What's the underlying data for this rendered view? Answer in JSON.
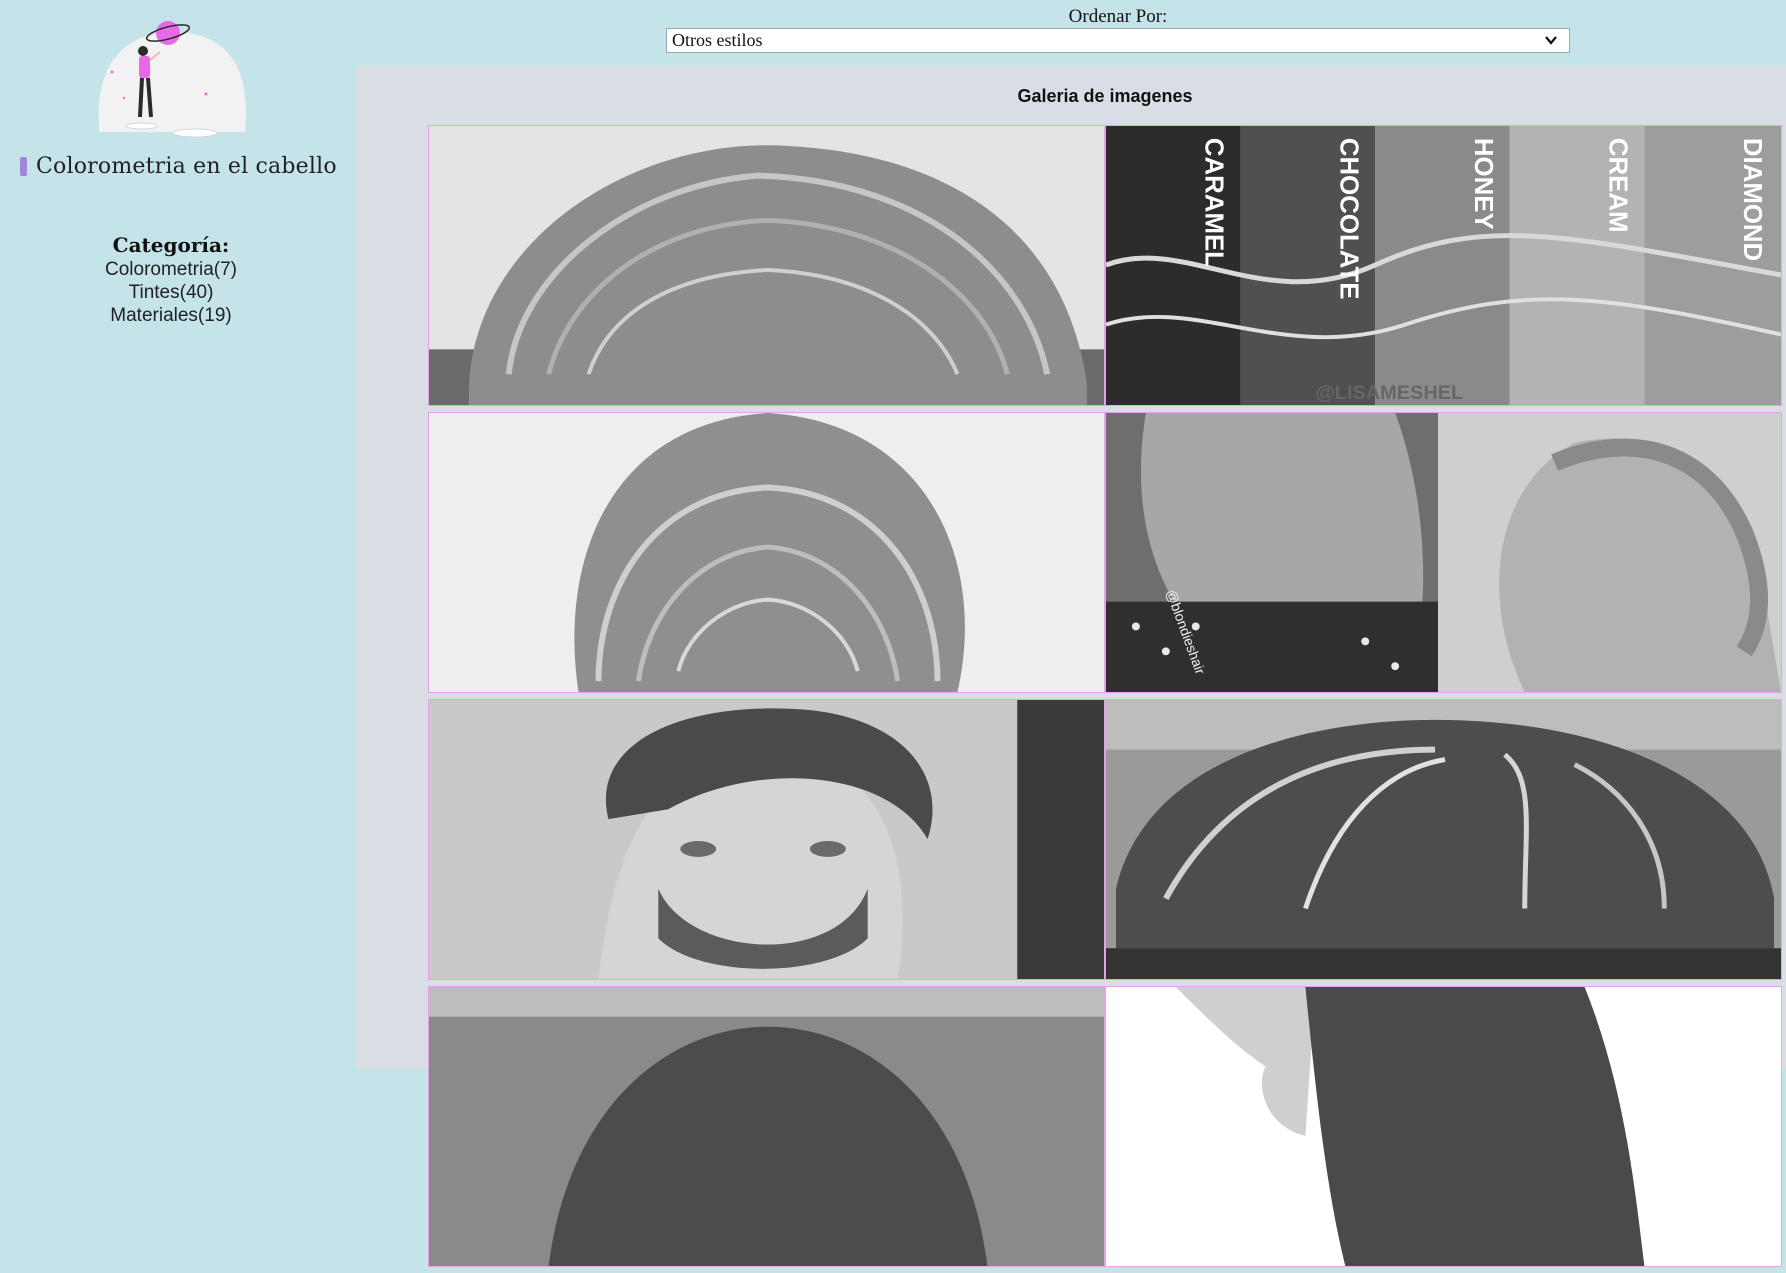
{
  "sidebar": {
    "site_name": "Colorometria en el cabello",
    "category_heading": "Categoría:",
    "categories": [
      {
        "label": "Colorometria(7)"
      },
      {
        "label": "Tintes(40)"
      },
      {
        "label": "Materiales(19)"
      }
    ]
  },
  "sort": {
    "label": "Ordenar Por:",
    "selected": "Otros estilos"
  },
  "gallery": {
    "title": "Galeria de imagenes",
    "images": [
      {
        "subject": "wavy-hair-back"
      },
      {
        "subject": "hair-color-shades",
        "overlay": [
          "CARAMEL",
          "CHOCOLATE",
          "HONEY",
          "CREAM",
          "DIAMOND"
        ],
        "credit": "@LISAMESHEL"
      },
      {
        "subject": "curly-hair-back"
      },
      {
        "subject": "curls-and-braid",
        "credit": "@blondieshair"
      },
      {
        "subject": "man-styled-hair"
      },
      {
        "subject": "highlighted-bob"
      },
      {
        "subject": "hair-top-partial"
      },
      {
        "subject": "profile-straight-hair"
      }
    ]
  },
  "colors": {
    "sidebar_bg": "#c5e4ea",
    "panel_bg": "#d9dee5",
    "image_border": "#e2a3e8",
    "accent_pink": "#e869e8",
    "accent_purple": "#9f86d9"
  }
}
